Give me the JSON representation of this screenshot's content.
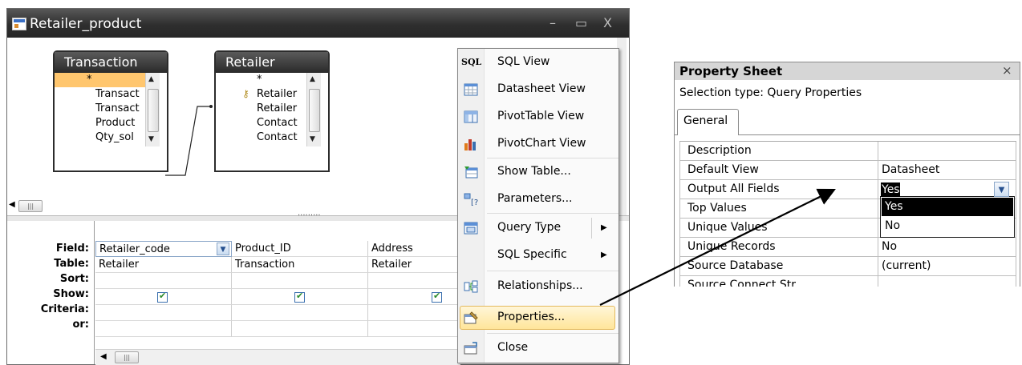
{
  "window": {
    "title": "Retailer_product",
    "minimize_glyph": "–",
    "maximize_glyph": "▭",
    "close_glyph": "X"
  },
  "design": {
    "tables": [
      {
        "name": "Transaction",
        "fields": [
          "*",
          "Transact",
          "Transact",
          "Product",
          "Qty_sol"
        ]
      },
      {
        "name": "Retailer",
        "fields": [
          "*",
          "Retailer",
          "Retailer",
          "Contact",
          "Contact"
        ]
      }
    ],
    "hscroll_thumb": "|||",
    "splitter_grip": "·········"
  },
  "grid": {
    "row_labels": [
      "Field:",
      "Table:",
      "Sort:",
      "Show:",
      "Criteria:",
      "or:"
    ],
    "columns": [
      {
        "field": "Retailer_code",
        "table": "Retailer",
        "show": true
      },
      {
        "field": "Product_ID",
        "table": "Transaction",
        "show": true
      },
      {
        "field": "Address",
        "table": "Retailer",
        "show": true
      }
    ],
    "hscroll_thumb": "|||"
  },
  "menu": {
    "items": [
      {
        "label": "SQL View",
        "icon": "sql-icon",
        "icon_text": "SQL"
      },
      {
        "label": "Datasheet View",
        "icon": "datasheet-icon"
      },
      {
        "label": "PivotTable View",
        "icon": "pivottable-icon"
      },
      {
        "label": "PivotChart View",
        "icon": "pivotchart-icon"
      },
      {
        "label": "Show Table...",
        "icon": "show-table-icon"
      },
      {
        "label": "Parameters...",
        "icon": "parameters-icon"
      },
      {
        "label": "Query Type",
        "icon": "query-type-icon",
        "submenu": true
      },
      {
        "label": "SQL Specific",
        "submenu": true
      },
      {
        "label": "Relationships...",
        "icon": "relationships-icon"
      },
      {
        "label": "Properties...",
        "icon": "properties-icon",
        "highlighted": true
      },
      {
        "label": "Close",
        "icon": "close-query-icon"
      }
    ],
    "submenu_glyph": "▶"
  },
  "property_sheet": {
    "title": "Property Sheet",
    "close_glyph": "×",
    "selection_type": "Selection type:  Query Properties",
    "tab": "General",
    "properties": [
      {
        "name": "Description",
        "value": ""
      },
      {
        "name": "Default View",
        "value": "Datasheet"
      },
      {
        "name": "Output All Fields",
        "value": "Yes"
      },
      {
        "name": "Top Values",
        "value": ""
      },
      {
        "name": "Unique Values",
        "value": ""
      },
      {
        "name": "Unique Records",
        "value": "No"
      },
      {
        "name": "Source Database",
        "value": "(current)"
      },
      {
        "name": "Source Connect Str",
        "value": ""
      }
    ],
    "dropdown_options": [
      "Yes",
      "No"
    ],
    "selected_option": "Yes"
  },
  "colors": {
    "titlebar": "#2f2f2f",
    "highlight_field": "#ffc66e",
    "menu_highlight": "#ffe59a",
    "checkbox": "#2a8a2a"
  }
}
